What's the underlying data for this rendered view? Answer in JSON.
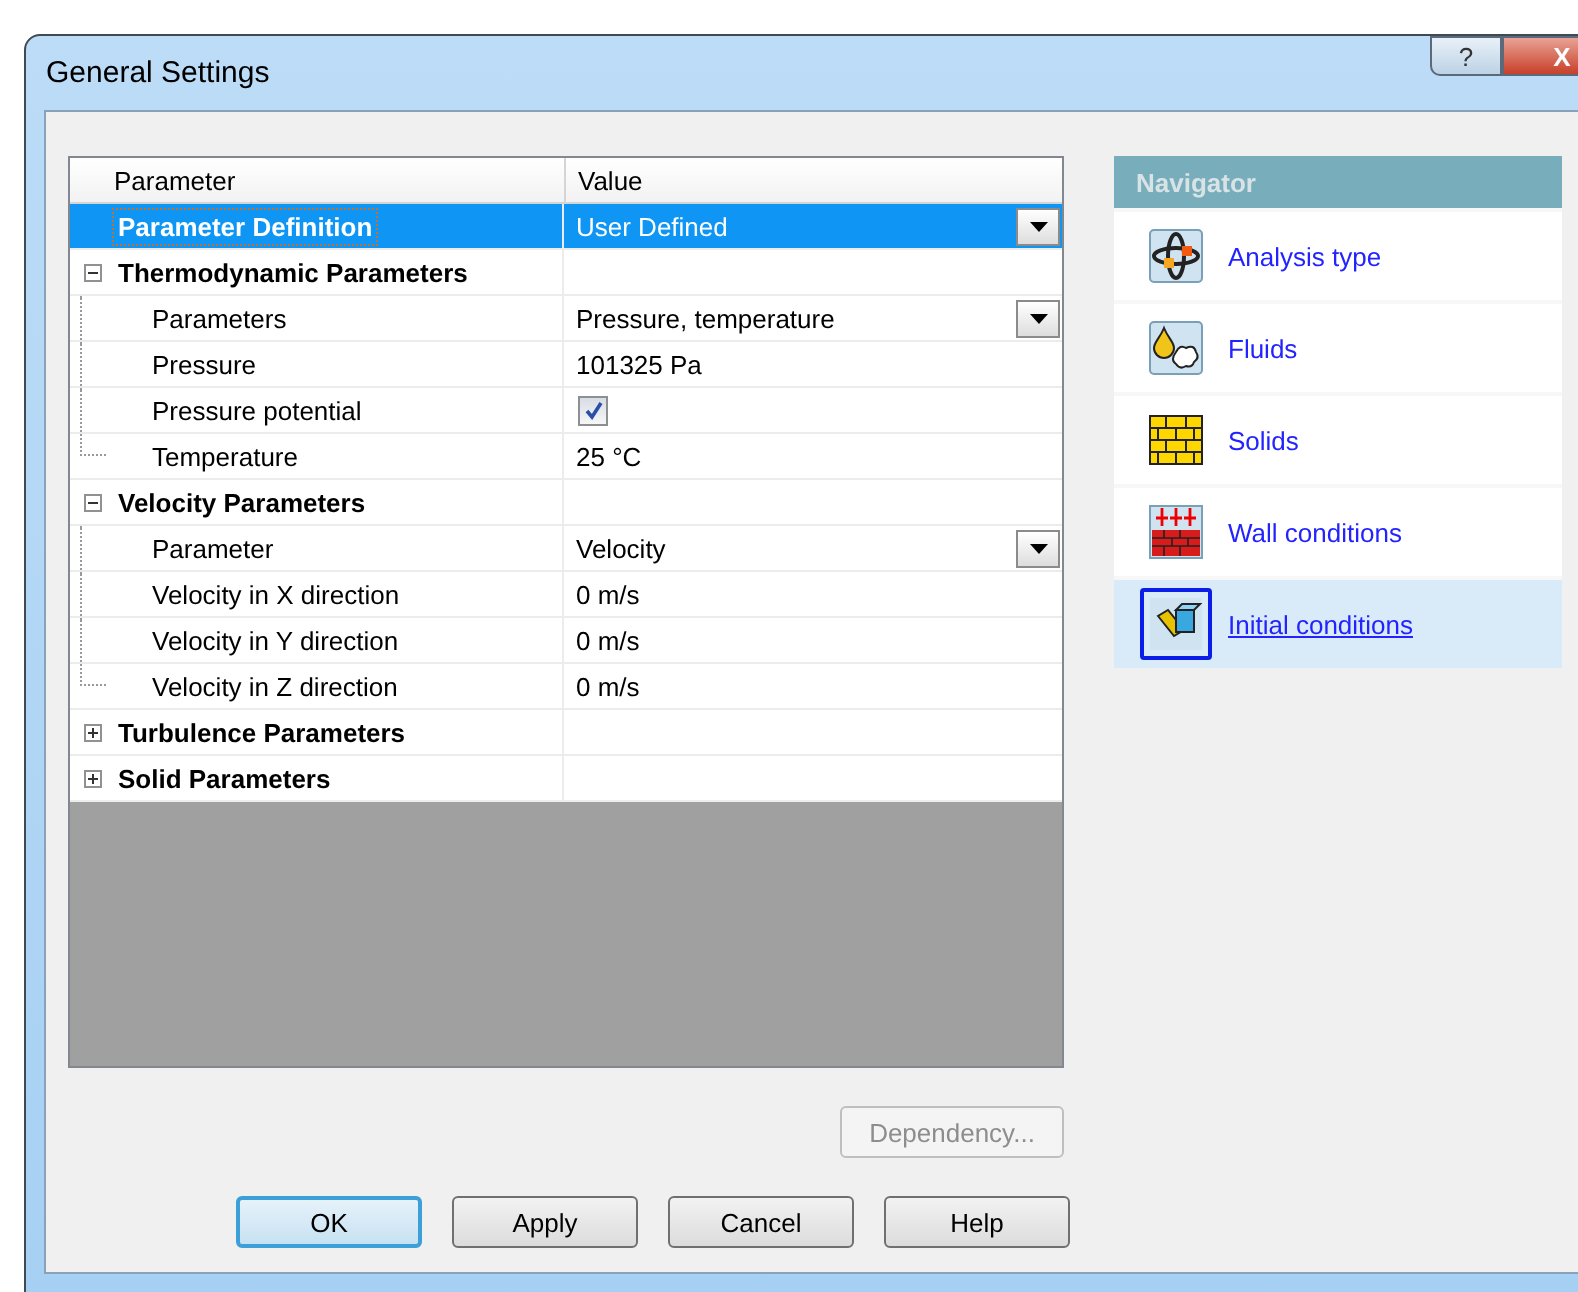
{
  "window": {
    "title": "General Settings",
    "help_glyph": "?",
    "close_glyph": "X"
  },
  "grid": {
    "columns": [
      "Parameter",
      "Value"
    ],
    "rows": [
      {
        "kind": "property",
        "label": "Parameter Definition",
        "value": "User Defined",
        "dropdown": true,
        "selected": true
      },
      {
        "kind": "group",
        "label": "Thermodynamic Parameters",
        "expanded": true,
        "selected": false,
        "children": [
          {
            "kind": "property",
            "label": "Parameters",
            "value": "Pressure, temperature",
            "dropdown": true,
            "selected": false
          },
          {
            "kind": "property",
            "label": "Pressure",
            "value": "101325 Pa",
            "dropdown": false,
            "selected": false
          },
          {
            "kind": "checkbox",
            "label": "Pressure potential",
            "checked": true,
            "selected": false
          },
          {
            "kind": "property",
            "label": "Temperature",
            "value": "25 °C",
            "dropdown": false,
            "selected": false
          }
        ]
      },
      {
        "kind": "group",
        "label": "Velocity Parameters",
        "expanded": true,
        "selected": false,
        "children": [
          {
            "kind": "property",
            "label": "Parameter",
            "value": "Velocity",
            "dropdown": true,
            "selected": false
          },
          {
            "kind": "property",
            "label": "Velocity in X direction",
            "value": "0 m/s",
            "dropdown": false,
            "selected": false
          },
          {
            "kind": "property",
            "label": "Velocity in Y direction",
            "value": "0 m/s",
            "dropdown": false,
            "selected": false
          },
          {
            "kind": "property",
            "label": "Velocity in Z direction",
            "value": "0 m/s",
            "dropdown": false,
            "selected": false
          }
        ]
      },
      {
        "kind": "group",
        "label": "Turbulence Parameters",
        "expanded": false,
        "selected": false,
        "children": []
      },
      {
        "kind": "group",
        "label": "Solid Parameters",
        "expanded": false,
        "selected": false,
        "children": []
      }
    ]
  },
  "navigator": {
    "title": "Navigator",
    "items": [
      {
        "label": "Analysis type",
        "selected": false
      },
      {
        "label": "Fluids",
        "selected": false
      },
      {
        "label": "Solids",
        "selected": false
      },
      {
        "label": "Wall conditions",
        "selected": false
      },
      {
        "label": "Initial conditions",
        "selected": true
      }
    ]
  },
  "dependency_button": {
    "label": "Dependency...",
    "disabled": true
  },
  "buttons": [
    {
      "label": "OK",
      "default": true
    },
    {
      "label": "Apply",
      "default": false
    },
    {
      "label": "Cancel",
      "default": false
    },
    {
      "label": "Help",
      "default": false
    }
  ]
}
